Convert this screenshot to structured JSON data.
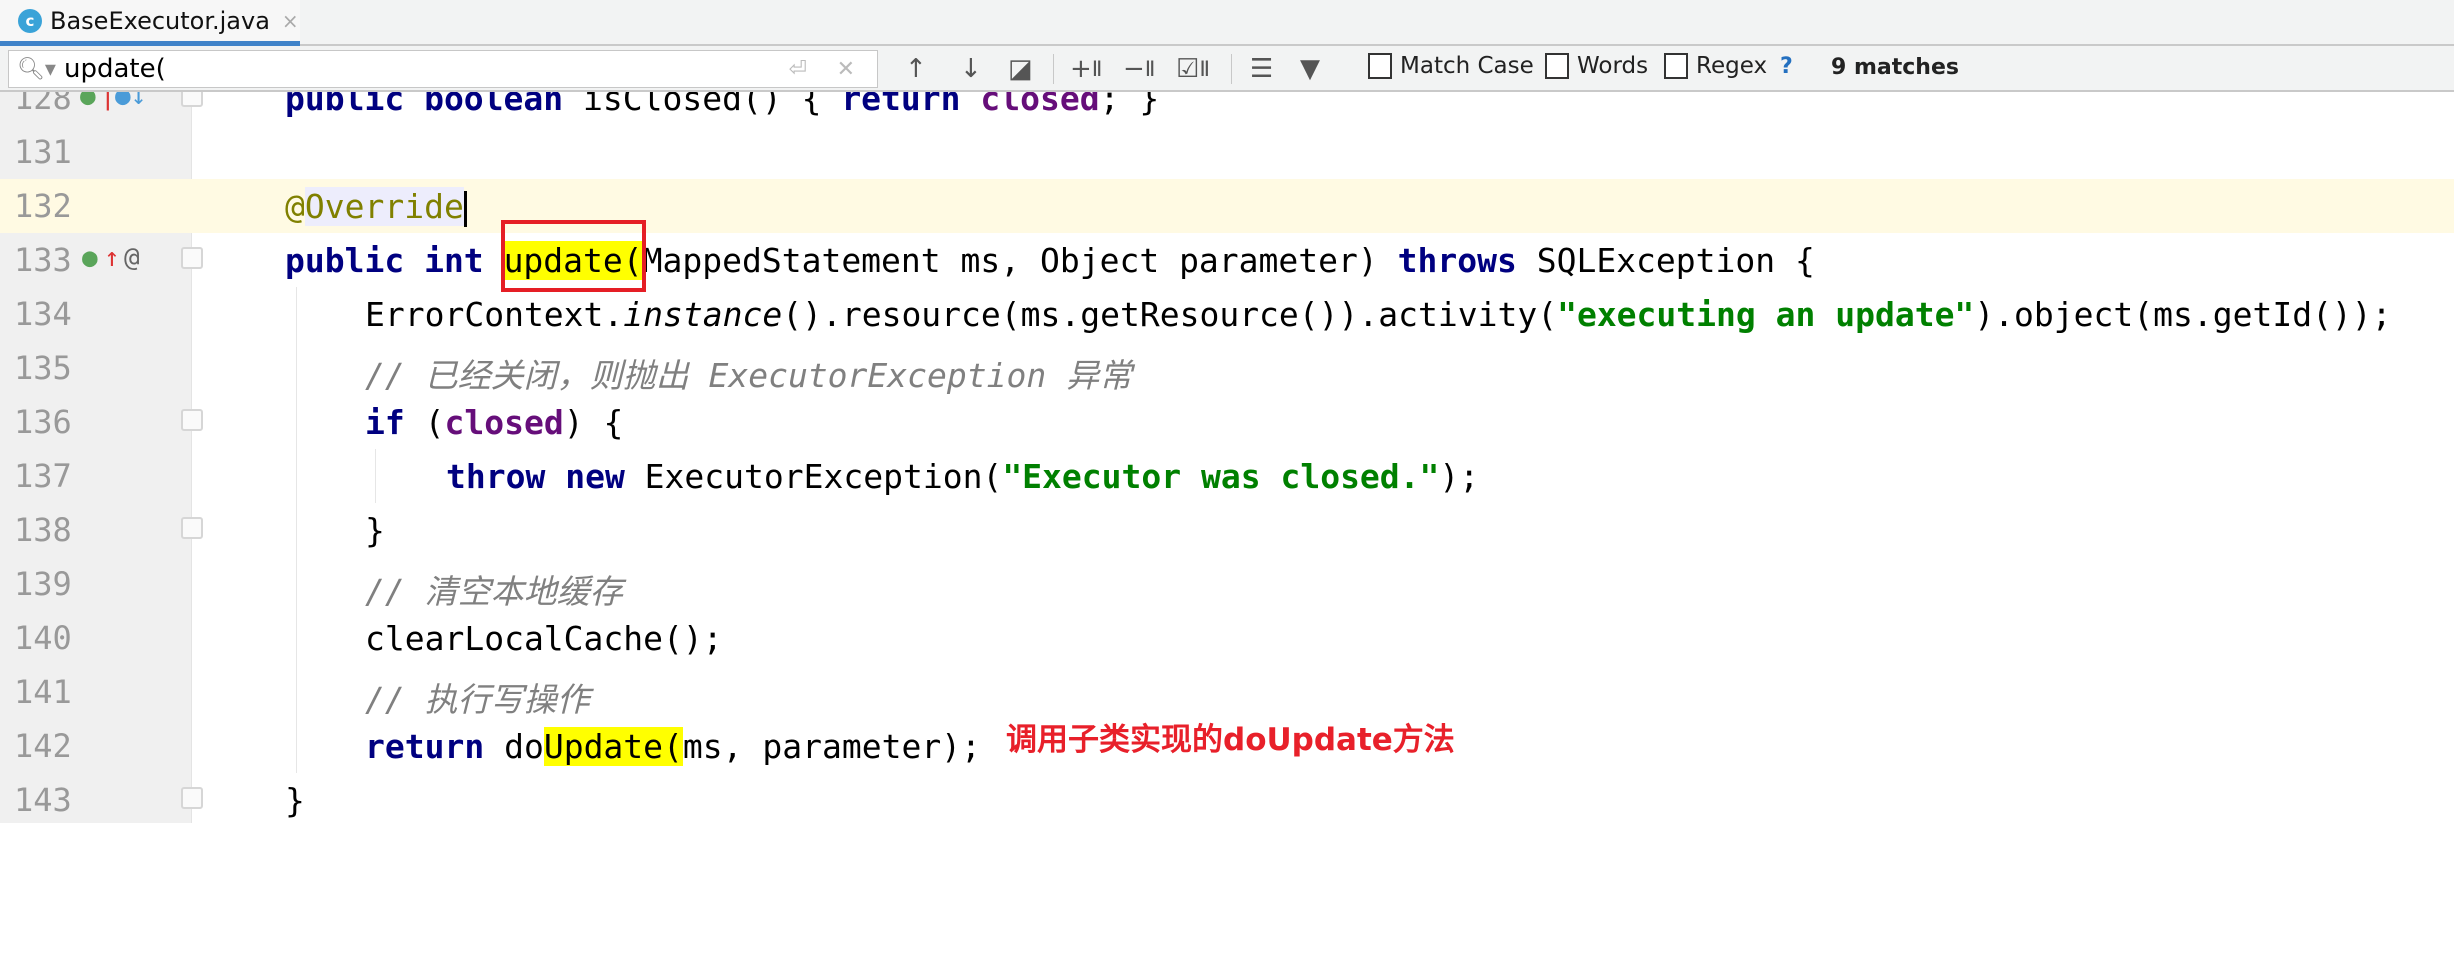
{
  "tab": {
    "file_name": "BaseExecutor.java",
    "icon": "java-class-icon",
    "close": "×"
  },
  "search": {
    "query": "update(",
    "options": {
      "match_case": "Match Case",
      "words": "Words",
      "regex": "Regex",
      "help": "?"
    },
    "match_count": "9 matches"
  },
  "editor": {
    "lines": [
      {
        "n": "128",
        "t": "public boolean isClosed() { return closed; }"
      },
      {
        "n": "131",
        "t": ""
      },
      {
        "n": "132",
        "t": "@Override"
      },
      {
        "n": "133",
        "t": "public int update(MappedStatement ms, Object parameter) throws SQLException {"
      },
      {
        "n": "134",
        "t": "ErrorContext.instance().resource(ms.getResource()).activity(\"executing an update\").object(ms.getId());"
      },
      {
        "n": "135",
        "t": "// 已经关闭，则抛出 ExecutorException 异常"
      },
      {
        "n": "136",
        "t": "if (closed) {"
      },
      {
        "n": "137",
        "t": "throw new ExecutorException(\"Executor was closed.\");"
      },
      {
        "n": "138",
        "t": "}"
      },
      {
        "n": "139",
        "t": "// 清空本地缓存"
      },
      {
        "n": "140",
        "t": "clearLocalCache();"
      },
      {
        "n": "141",
        "t": "// 执行写操作"
      },
      {
        "n": "142",
        "t": "return doUpdate(ms, parameter);"
      },
      {
        "n": "143",
        "t": "}"
      }
    ],
    "current_line": "132"
  },
  "annotation": {
    "text": "调用子类实现的doUpdate方法",
    "color": "#e8202a"
  },
  "colors": {
    "keyword": "#000080",
    "string": "#008000",
    "field": "#660e7a",
    "comment": "#808080",
    "match_highlight": "#ffff00",
    "current_line": "#fffae3"
  }
}
